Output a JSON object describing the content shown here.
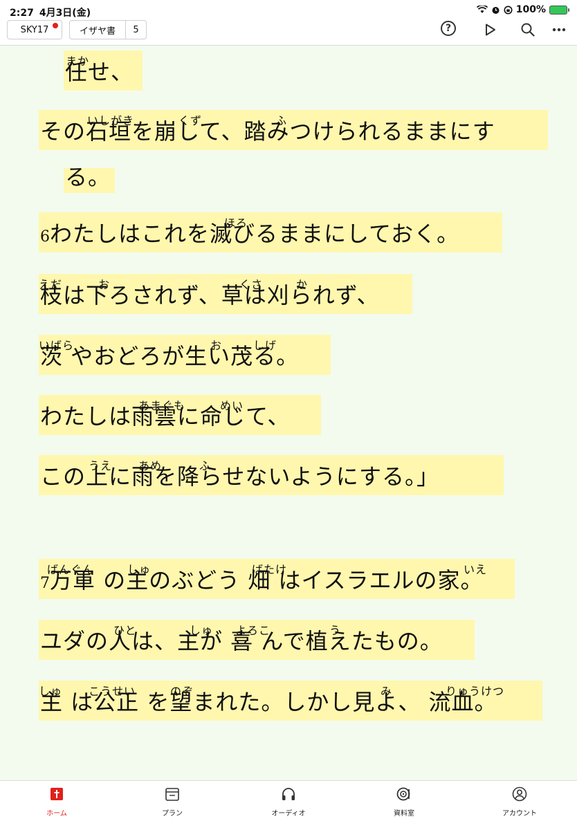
{
  "status_bar": {
    "time": "2:27",
    "date": "4月3日(金)",
    "battery": "100%"
  },
  "toolbar": {
    "version": "SKY17",
    "book": "イザヤ書",
    "chapter": "5",
    "icons": [
      "help-icon",
      "play-icon",
      "search-icon",
      "more-icon"
    ]
  },
  "reader": {
    "highlight_color": "#fff7ae",
    "lines": [
      {
        "text": "任せ、",
        "ruby": [
          {
            "reading": "まか"
          }
        ]
      },
      {
        "text": "その石垣を崩して、踏みつけられるままにす",
        "ruby": [
          {
            "reading": "いしがき"
          },
          {
            "reading": "くず"
          },
          {
            "reading": "ふ"
          }
        ]
      },
      {
        "text": "る。",
        "ruby": []
      },
      {
        "verse": "6",
        "text": "わたしはこれを滅びるままにしておく。",
        "ruby": [
          {
            "reading": "ほろ"
          }
        ]
      },
      {
        "text": "枝は下ろされず、草は刈られず、",
        "ruby": [
          {
            "reading": "えだ"
          },
          {
            "reading": "お"
          },
          {
            "reading": "くさ"
          },
          {
            "reading": "か"
          }
        ]
      },
      {
        "text": "茨 やおどろが生い茂る。",
        "ruby": [
          {
            "reading": "いばら"
          },
          {
            "reading": "お"
          },
          {
            "reading": "しげ"
          }
        ]
      },
      {
        "text": "わたしは雨雲に命じて、",
        "ruby": [
          {
            "reading": "あまぐも"
          },
          {
            "reading": "めい"
          }
        ]
      },
      {
        "text": "この上に雨を降らせないようにする。」",
        "ruby": [
          {
            "reading": "うえ"
          },
          {
            "reading": "あめ"
          },
          {
            "reading": "ふ"
          }
        ]
      },
      {
        "verse": "7",
        "text": "万軍 の主のぶどう 畑 はイスラエルの家。",
        "ruby": [
          {
            "reading": "ばんぐん"
          },
          {
            "reading": "しゅ"
          },
          {
            "reading": "ばたけ"
          },
          {
            "reading": "いえ"
          }
        ]
      },
      {
        "text": "ユダの人は、主が 喜 んで植えたもの。",
        "ruby": [
          {
            "reading": "ひと"
          },
          {
            "reading": "しゅ"
          },
          {
            "reading": "よろこ"
          },
          {
            "reading": "う"
          }
        ]
      },
      {
        "text": "主 は公正 を望まれた。しかし見よ、 流血。",
        "ruby": [
          {
            "reading": "しゅ"
          },
          {
            "reading": "こうせい"
          },
          {
            "reading": "のぞ"
          },
          {
            "reading": "み"
          },
          {
            "reading": "りゅうけつ"
          }
        ]
      }
    ]
  },
  "tabbar": {
    "active_color": "#e0211b",
    "tabs": [
      {
        "label": "ホーム",
        "icon": "home-book-icon",
        "active": true
      },
      {
        "label": "プラン",
        "icon": "calendar-icon",
        "active": false
      },
      {
        "label": "オーディオ",
        "icon": "headphones-icon",
        "active": false
      },
      {
        "label": "資料室",
        "icon": "library-icon",
        "active": false
      },
      {
        "label": "アカウント",
        "icon": "account-icon",
        "active": false
      }
    ]
  }
}
